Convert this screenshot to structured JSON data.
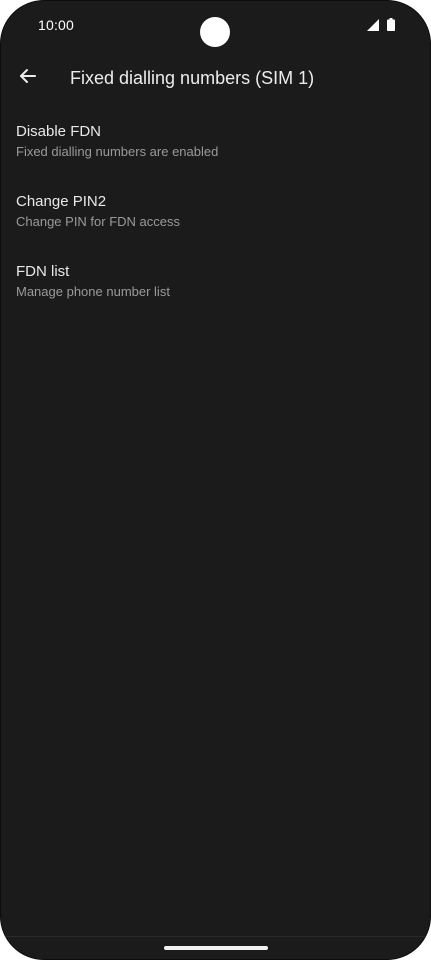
{
  "status_bar": {
    "time": "10:00",
    "icons": [
      "signal-icon",
      "battery-icon"
    ]
  },
  "app_bar": {
    "title": "Fixed dialling numbers (SIM 1)",
    "back_icon": "arrow-back-icon"
  },
  "preferences": [
    {
      "title": "Disable FDN",
      "summary": "Fixed dialling numbers are enabled"
    },
    {
      "title": "Change PIN2",
      "summary": "Change PIN for FDN access"
    },
    {
      "title": "FDN list",
      "summary": "Manage phone number list"
    }
  ],
  "colors": {
    "background": "#1b1b1b",
    "title_text": "#e8e8e8",
    "summary_text": "#9a9a9a"
  }
}
